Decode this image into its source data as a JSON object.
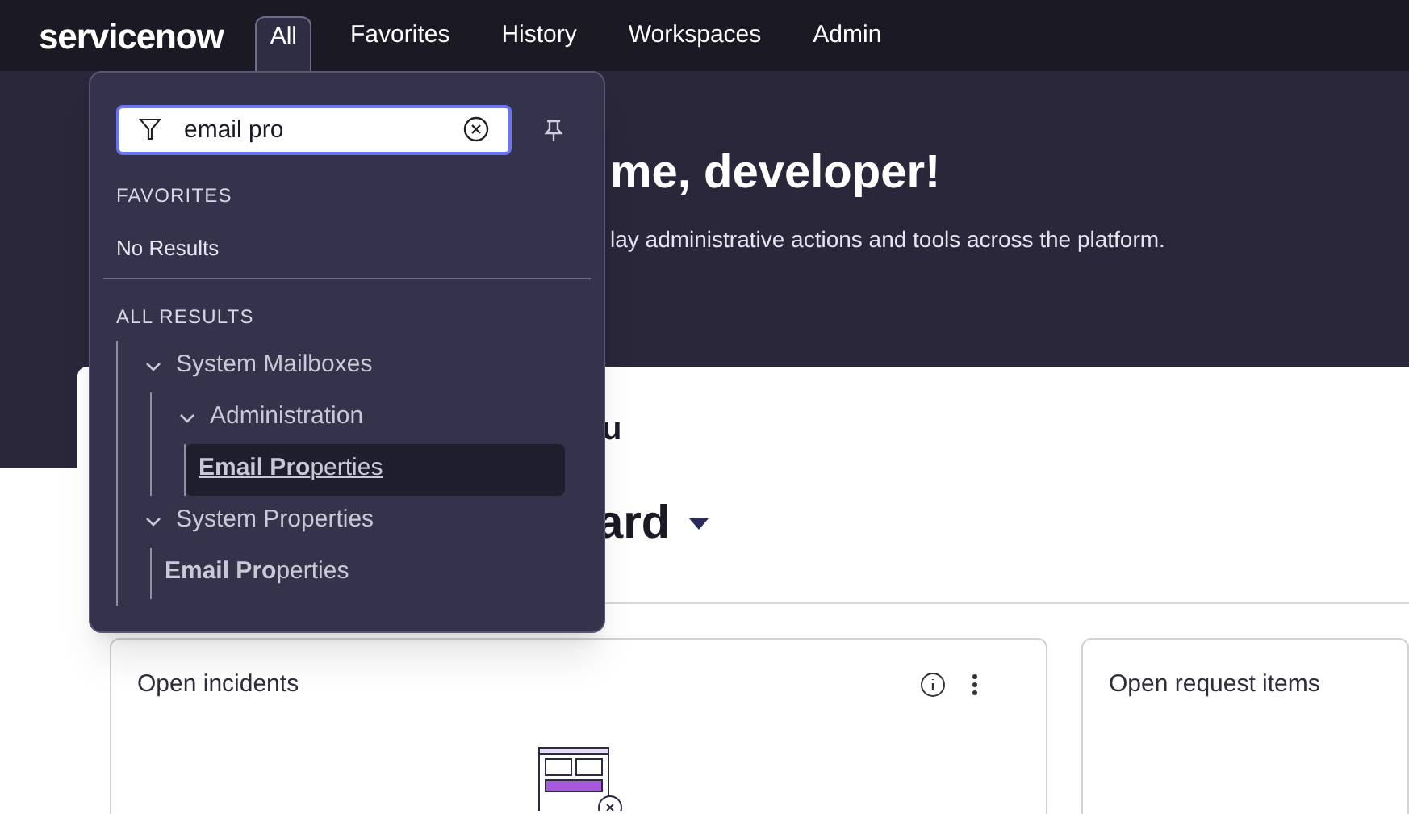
{
  "nav": {
    "logo": "servicenow",
    "tabs": [
      {
        "label": "All",
        "selected": true
      },
      {
        "label": "Favorites",
        "selected": false
      },
      {
        "label": "History",
        "selected": false
      },
      {
        "label": "Workspaces",
        "selected": false
      },
      {
        "label": "Admin",
        "selected": false
      }
    ]
  },
  "hero": {
    "title_end": "me, developer!",
    "subtitle_end": "lay administrative actions and tools across the platform."
  },
  "content": {
    "section_end": "u",
    "dashboard_end": "ard",
    "cards": [
      {
        "title": "Open incidents",
        "actions": true,
        "empty_state": true
      },
      {
        "title": "Open request items",
        "actions": false,
        "empty_state": false
      }
    ]
  },
  "menu": {
    "search": {
      "value": "email pro"
    },
    "favorites_heading": "FAVORITES",
    "favorites_empty": "No Results",
    "results_heading": "ALL RESULTS",
    "tree": [
      {
        "label": "System Mailboxes",
        "expanded": true,
        "children": [
          {
            "label": "Administration",
            "expanded": true,
            "children": [
              {
                "label": "**Email Pro**perties",
                "selected": true
              }
            ]
          }
        ]
      },
      {
        "label": "System Properties",
        "expanded": true,
        "children": [
          {
            "label": "**Email Pro**perties",
            "selected": false
          }
        ]
      }
    ]
  }
}
